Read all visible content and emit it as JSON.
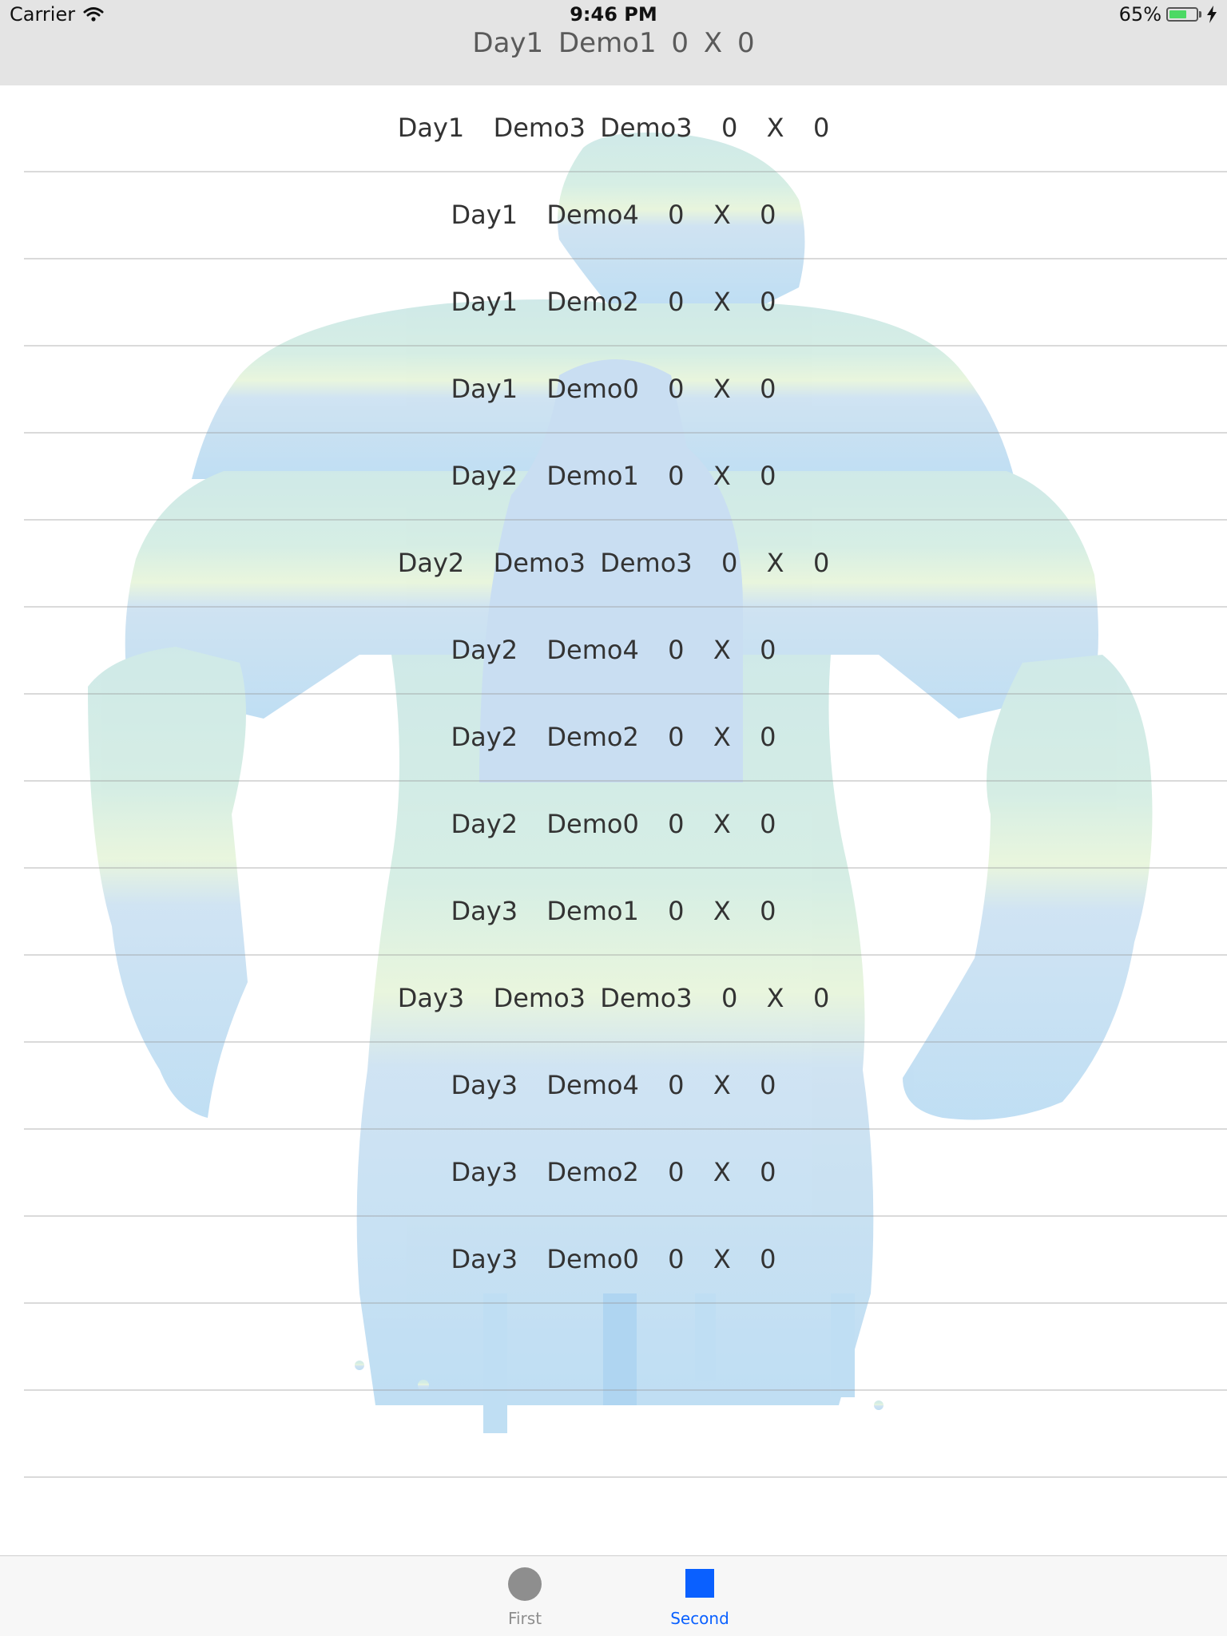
{
  "status_bar": {
    "carrier": "Carrier",
    "time": "9:46 PM",
    "battery": "65%",
    "battery_level": 0.65
  },
  "nav": {
    "title": "Day1  Demo1  0  X  0"
  },
  "table": {
    "rows": [
      "Day1  Demo3 Demo3  0  X  0",
      "Day1  Demo4  0  X  0",
      "Day1  Demo2  0  X  0",
      "Day1  Demo0  0  X  0",
      "Day2  Demo1  0  X  0",
      "Day2  Demo3 Demo3  0  X  0",
      "Day2  Demo4  0  X  0",
      "Day2  Demo2  0  X  0",
      "Day2  Demo0  0  X  0",
      "Day3  Demo1  0  X  0",
      "Day3  Demo3 Demo3  0  X  0",
      "Day3  Demo4  0  X  0",
      "Day3  Demo2  0  X  0",
      "Day3  Demo0  0  X  0",
      "",
      "",
      ""
    ]
  },
  "tabbar": {
    "first_label": "First",
    "second_label": "Second",
    "active_color": "#0a60ff",
    "inactive_color": "#8e8e8e"
  },
  "background": {
    "icon": "muscular-figure-silhouette"
  }
}
